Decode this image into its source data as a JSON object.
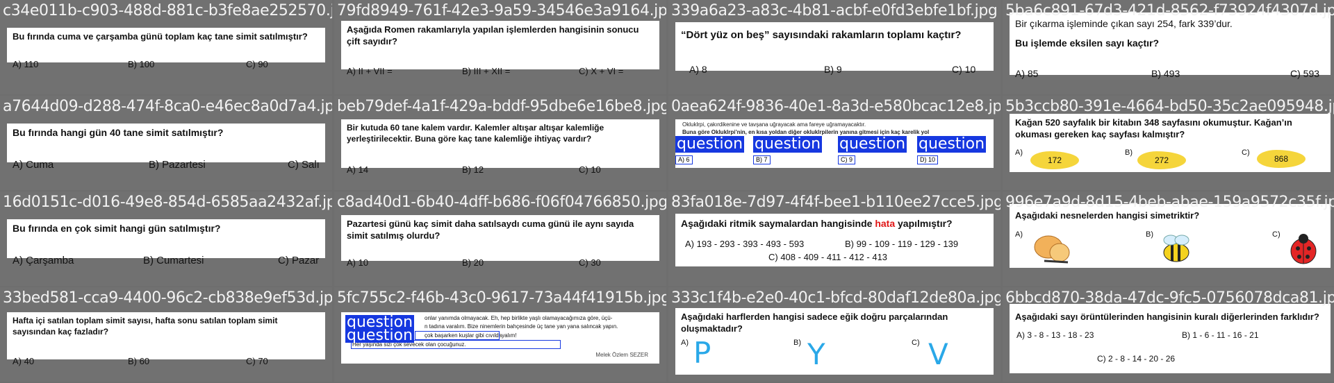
{
  "cells": [
    {
      "file": "c34e011b-c903-488d-881c-b3fe8ae252570.jpg",
      "q": "Bu fırında cuma ve çarşamba günü toplam kaç tane simit satılmıştır?",
      "opts": [
        "A) 110",
        "B) 100",
        "C) 90"
      ]
    },
    {
      "file": "79fd8949-761f-42e3-9a59-34546e3a9164.jpg",
      "q": "Aşağıda Romen rakamlarıyla yapılan işlemlerden hangisinin sonucu çift sayıdır?",
      "opts": [
        "A) II + VII =",
        "B) III + XII =",
        "C) X + VI ="
      ]
    },
    {
      "file": "339a6a23-a83c-4b81-acbf-e0fd3ebfe1bf.jpg",
      "q": "“Dört yüz on beş” sayısındaki rakamların toplamı kaçtır?",
      "opts": [
        "A) 8",
        "B) 9",
        "C) 10"
      ]
    },
    {
      "file": "5ba6c891-67d3-421d-8562-f73924f4307d.jpg",
      "pre": "Bir çıkarma işleminde çıkan sayı 254, fark 339’dur.",
      "q": "Bu işlemde eksilen sayı kaçtır?",
      "opts": [
        "A) 85",
        "B) 493",
        "C) 593"
      ]
    },
    {
      "file": "a7644d09-d288-474f-8ca0-e46ec8a0d7a4.jpg",
      "q": "Bu fırında hangi gün 40 tane simit satılmıştır?",
      "opts": [
        "A) Cuma",
        "B) Pazartesi",
        "C) Salı"
      ]
    },
    {
      "file": "beb79def-4a1f-429a-bddf-95dbe6e16be8.jpg",
      "q": "Bir kutuda 60 tane kalem vardır. Kalemler altışar altışar kalemliğe yerleştirilecektir. Buna göre kaç tane kalemliğe ihtiyaç vardır?",
      "opts": [
        "A) 14",
        "B) 12",
        "C) 10"
      ]
    },
    {
      "file": "0aea624f-9836-40e1-8a3d-e580bcac12e8.jpg",
      "small1": "Okluklrpi, çakırdikenine ve tavşana uğrayacak ama fareye uğramayacaktır.",
      "small2": "Buna göre Okluklrpi’nin, en kısa yoldan diğer okluklrpilerin yanına gitmesi için kaç karelik yol",
      "box": "question",
      "opts": [
        "A) 6",
        "B) 7",
        "C) 9",
        "D) 10"
      ]
    },
    {
      "file": "5b3ccb80-391e-4664-bd50-35c2ae095948.jpg",
      "q": "Kağan 520 sayfalık bir kitabın 348 sayfasını okumuştur. Kağan’ın okuması gereken kaç sayfası kalmıştır?",
      "opts": [
        "A)",
        "B)",
        "C)"
      ],
      "vals": [
        "172",
        "272",
        "868"
      ]
    },
    {
      "file": "16d0151c-d016-49e8-854d-6585aa2432af.jpg",
      "q": "Bu fırında en çok simit hangi gün satılmıştır?",
      "opts": [
        "A) Çarşamba",
        "B) Cumartesi",
        "C) Pazar"
      ]
    },
    {
      "file": "c8ad40d1-6b40-4dff-b686-f06f04766850.jpg",
      "q": "Pazartesi günü kaç simit daha satılsaydı cuma günü ile aynı sayıda simit satılmış olurdu?",
      "opts": [
        "A) 10",
        "B) 20",
        "C) 30"
      ]
    },
    {
      "file": "83fa018e-7d97-4f4f-bee1-b110ee27cce5.jpg",
      "q_a": "Aşağıdaki ritmik saymalardan hangisinde ",
      "q_b": "hata",
      "q_c": " yapılmıştır?",
      "opts": [
        "A) 193 - 293 - 393 - 493 - 593",
        "B) 99 - 109 - 119 - 129 - 139",
        "C) 408 - 409 - 411 - 412 - 413"
      ]
    },
    {
      "file": "996e7a9d-8d15-4beb-abae-159a9572c35f.jpg",
      "q": "Aşağıdaki nesnelerden hangisi simetriktir?",
      "opts": [
        "A)",
        "B)",
        "C)"
      ]
    },
    {
      "file": "33bed581-cca9-4400-96c2-cb838e9ef53d.jpg",
      "q": "Hafta içi satılan toplam simit sayısı, hafta sonu satılan toplam simit sayısından kaç fazladır?",
      "opts": [
        "A) 40",
        "B) 60",
        "C) 70"
      ]
    },
    {
      "file": "5fc755c2-f46b-43c0-9617-73a44f41915b.jpg",
      "l1": "onlar yanımda olmayacak. Eh, hep birlikte yaşlı olamayacağımıza göre, üçü-",
      "l2": "n tadına varalım. Bize ninemlerin bahçesinde üç tane yan yana salıncak yapın.",
      "l3": "çok başarken kuşlar gibi cıvıldayalım!",
      "l4": "Her yaşında sizi çok sevecek olan çocuğunuz.",
      "author": "Melek Özlem SEZER",
      "box": "question"
    },
    {
      "file": "333c1f4b-e2e0-40c1-bfcd-80daf12de80a.jpg",
      "q": "Aşağıdaki harflerden hangisi sadece eğik doğru parçalarından oluşmaktadır?",
      "opts": [
        "A)",
        "B)",
        "C)"
      ],
      "letters": [
        "P",
        "Y",
        "V"
      ]
    },
    {
      "file": "6bbcd870-38da-47dc-9fc5-0756078dca81.jpg",
      "q": "Aşağıdaki sayı örüntülerinden hangisinin kuralı diğerlerinden farklıdır?",
      "opts": [
        "A) 3 - 8 - 13 - 18 - 23",
        "B) 1 - 6 - 11 - 16 - 21",
        "C) 2 - 8 - 14 - 20 - 26"
      ]
    }
  ]
}
